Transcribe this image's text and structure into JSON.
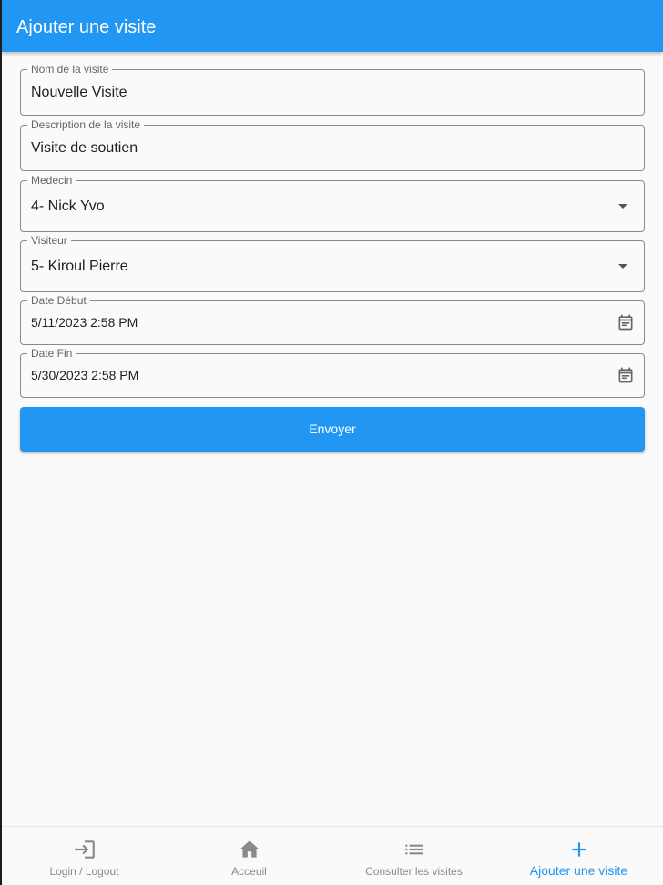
{
  "appbar": {
    "title": "Ajouter une visite"
  },
  "form": {
    "nom": {
      "label": "Nom de la visite",
      "value": "Nouvelle Visite"
    },
    "description": {
      "label": "Description de la visite",
      "value": "Visite de soutien"
    },
    "medecin": {
      "label": "Medecin",
      "value": "4- Nick Yvo"
    },
    "visiteur": {
      "label": "Visiteur",
      "value": "5- Kiroul Pierre"
    },
    "date_debut": {
      "label": "Date Début",
      "value": "5/11/2023 2:58 PM"
    },
    "date_fin": {
      "label": "Date Fin",
      "value": "5/30/2023 2:58 PM"
    },
    "submit_label": "Envoyer"
  },
  "bottom_nav": {
    "items": [
      {
        "label": "Login / Logout",
        "icon": "login-icon",
        "active": false
      },
      {
        "label": "Acceuil",
        "icon": "home-icon",
        "active": false
      },
      {
        "label": "Consulter les visites",
        "icon": "list-icon",
        "active": false
      },
      {
        "label": "Ajouter une visite",
        "icon": "add-icon",
        "active": true
      }
    ]
  },
  "colors": {
    "primary": "#2196f3",
    "background": "#fafafa",
    "inactive": "#8a8a8a"
  }
}
